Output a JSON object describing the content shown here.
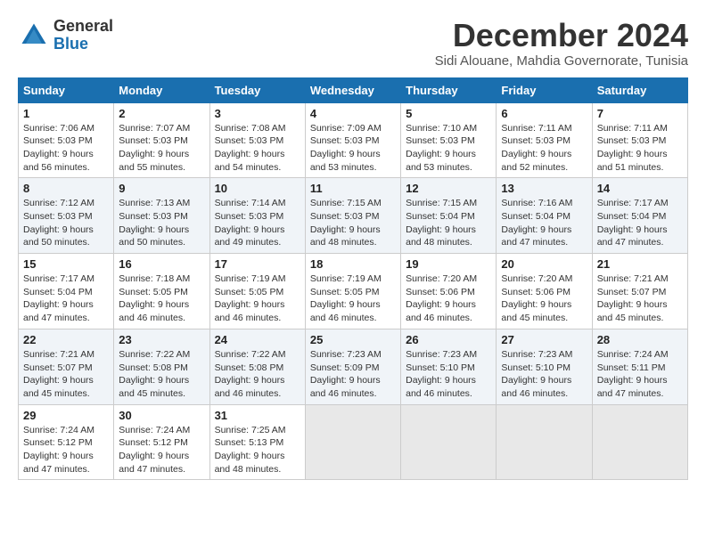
{
  "header": {
    "logo_line1": "General",
    "logo_line2": "Blue",
    "month_title": "December 2024",
    "subtitle": "Sidi Alouane, Mahdia Governorate, Tunisia"
  },
  "weekdays": [
    "Sunday",
    "Monday",
    "Tuesday",
    "Wednesday",
    "Thursday",
    "Friday",
    "Saturday"
  ],
  "weeks": [
    [
      {
        "day": "1",
        "sunrise": "Sunrise: 7:06 AM",
        "sunset": "Sunset: 5:03 PM",
        "daylight": "Daylight: 9 hours and 56 minutes."
      },
      {
        "day": "2",
        "sunrise": "Sunrise: 7:07 AM",
        "sunset": "Sunset: 5:03 PM",
        "daylight": "Daylight: 9 hours and 55 minutes."
      },
      {
        "day": "3",
        "sunrise": "Sunrise: 7:08 AM",
        "sunset": "Sunset: 5:03 PM",
        "daylight": "Daylight: 9 hours and 54 minutes."
      },
      {
        "day": "4",
        "sunrise": "Sunrise: 7:09 AM",
        "sunset": "Sunset: 5:03 PM",
        "daylight": "Daylight: 9 hours and 53 minutes."
      },
      {
        "day": "5",
        "sunrise": "Sunrise: 7:10 AM",
        "sunset": "Sunset: 5:03 PM",
        "daylight": "Daylight: 9 hours and 53 minutes."
      },
      {
        "day": "6",
        "sunrise": "Sunrise: 7:11 AM",
        "sunset": "Sunset: 5:03 PM",
        "daylight": "Daylight: 9 hours and 52 minutes."
      },
      {
        "day": "7",
        "sunrise": "Sunrise: 7:11 AM",
        "sunset": "Sunset: 5:03 PM",
        "daylight": "Daylight: 9 hours and 51 minutes."
      }
    ],
    [
      {
        "day": "8",
        "sunrise": "Sunrise: 7:12 AM",
        "sunset": "Sunset: 5:03 PM",
        "daylight": "Daylight: 9 hours and 50 minutes."
      },
      {
        "day": "9",
        "sunrise": "Sunrise: 7:13 AM",
        "sunset": "Sunset: 5:03 PM",
        "daylight": "Daylight: 9 hours and 50 minutes."
      },
      {
        "day": "10",
        "sunrise": "Sunrise: 7:14 AM",
        "sunset": "Sunset: 5:03 PM",
        "daylight": "Daylight: 9 hours and 49 minutes."
      },
      {
        "day": "11",
        "sunrise": "Sunrise: 7:15 AM",
        "sunset": "Sunset: 5:03 PM",
        "daylight": "Daylight: 9 hours and 48 minutes."
      },
      {
        "day": "12",
        "sunrise": "Sunrise: 7:15 AM",
        "sunset": "Sunset: 5:04 PM",
        "daylight": "Daylight: 9 hours and 48 minutes."
      },
      {
        "day": "13",
        "sunrise": "Sunrise: 7:16 AM",
        "sunset": "Sunset: 5:04 PM",
        "daylight": "Daylight: 9 hours and 47 minutes."
      },
      {
        "day": "14",
        "sunrise": "Sunrise: 7:17 AM",
        "sunset": "Sunset: 5:04 PM",
        "daylight": "Daylight: 9 hours and 47 minutes."
      }
    ],
    [
      {
        "day": "15",
        "sunrise": "Sunrise: 7:17 AM",
        "sunset": "Sunset: 5:04 PM",
        "daylight": "Daylight: 9 hours and 47 minutes."
      },
      {
        "day": "16",
        "sunrise": "Sunrise: 7:18 AM",
        "sunset": "Sunset: 5:05 PM",
        "daylight": "Daylight: 9 hours and 46 minutes."
      },
      {
        "day": "17",
        "sunrise": "Sunrise: 7:19 AM",
        "sunset": "Sunset: 5:05 PM",
        "daylight": "Daylight: 9 hours and 46 minutes."
      },
      {
        "day": "18",
        "sunrise": "Sunrise: 7:19 AM",
        "sunset": "Sunset: 5:05 PM",
        "daylight": "Daylight: 9 hours and 46 minutes."
      },
      {
        "day": "19",
        "sunrise": "Sunrise: 7:20 AM",
        "sunset": "Sunset: 5:06 PM",
        "daylight": "Daylight: 9 hours and 46 minutes."
      },
      {
        "day": "20",
        "sunrise": "Sunrise: 7:20 AM",
        "sunset": "Sunset: 5:06 PM",
        "daylight": "Daylight: 9 hours and 45 minutes."
      },
      {
        "day": "21",
        "sunrise": "Sunrise: 7:21 AM",
        "sunset": "Sunset: 5:07 PM",
        "daylight": "Daylight: 9 hours and 45 minutes."
      }
    ],
    [
      {
        "day": "22",
        "sunrise": "Sunrise: 7:21 AM",
        "sunset": "Sunset: 5:07 PM",
        "daylight": "Daylight: 9 hours and 45 minutes."
      },
      {
        "day": "23",
        "sunrise": "Sunrise: 7:22 AM",
        "sunset": "Sunset: 5:08 PM",
        "daylight": "Daylight: 9 hours and 45 minutes."
      },
      {
        "day": "24",
        "sunrise": "Sunrise: 7:22 AM",
        "sunset": "Sunset: 5:08 PM",
        "daylight": "Daylight: 9 hours and 46 minutes."
      },
      {
        "day": "25",
        "sunrise": "Sunrise: 7:23 AM",
        "sunset": "Sunset: 5:09 PM",
        "daylight": "Daylight: 9 hours and 46 minutes."
      },
      {
        "day": "26",
        "sunrise": "Sunrise: 7:23 AM",
        "sunset": "Sunset: 5:10 PM",
        "daylight": "Daylight: 9 hours and 46 minutes."
      },
      {
        "day": "27",
        "sunrise": "Sunrise: 7:23 AM",
        "sunset": "Sunset: 5:10 PM",
        "daylight": "Daylight: 9 hours and 46 minutes."
      },
      {
        "day": "28",
        "sunrise": "Sunrise: 7:24 AM",
        "sunset": "Sunset: 5:11 PM",
        "daylight": "Daylight: 9 hours and 47 minutes."
      }
    ],
    [
      {
        "day": "29",
        "sunrise": "Sunrise: 7:24 AM",
        "sunset": "Sunset: 5:12 PM",
        "daylight": "Daylight: 9 hours and 47 minutes."
      },
      {
        "day": "30",
        "sunrise": "Sunrise: 7:24 AM",
        "sunset": "Sunset: 5:12 PM",
        "daylight": "Daylight: 9 hours and 47 minutes."
      },
      {
        "day": "31",
        "sunrise": "Sunrise: 7:25 AM",
        "sunset": "Sunset: 5:13 PM",
        "daylight": "Daylight: 9 hours and 48 minutes."
      },
      null,
      null,
      null,
      null
    ]
  ]
}
